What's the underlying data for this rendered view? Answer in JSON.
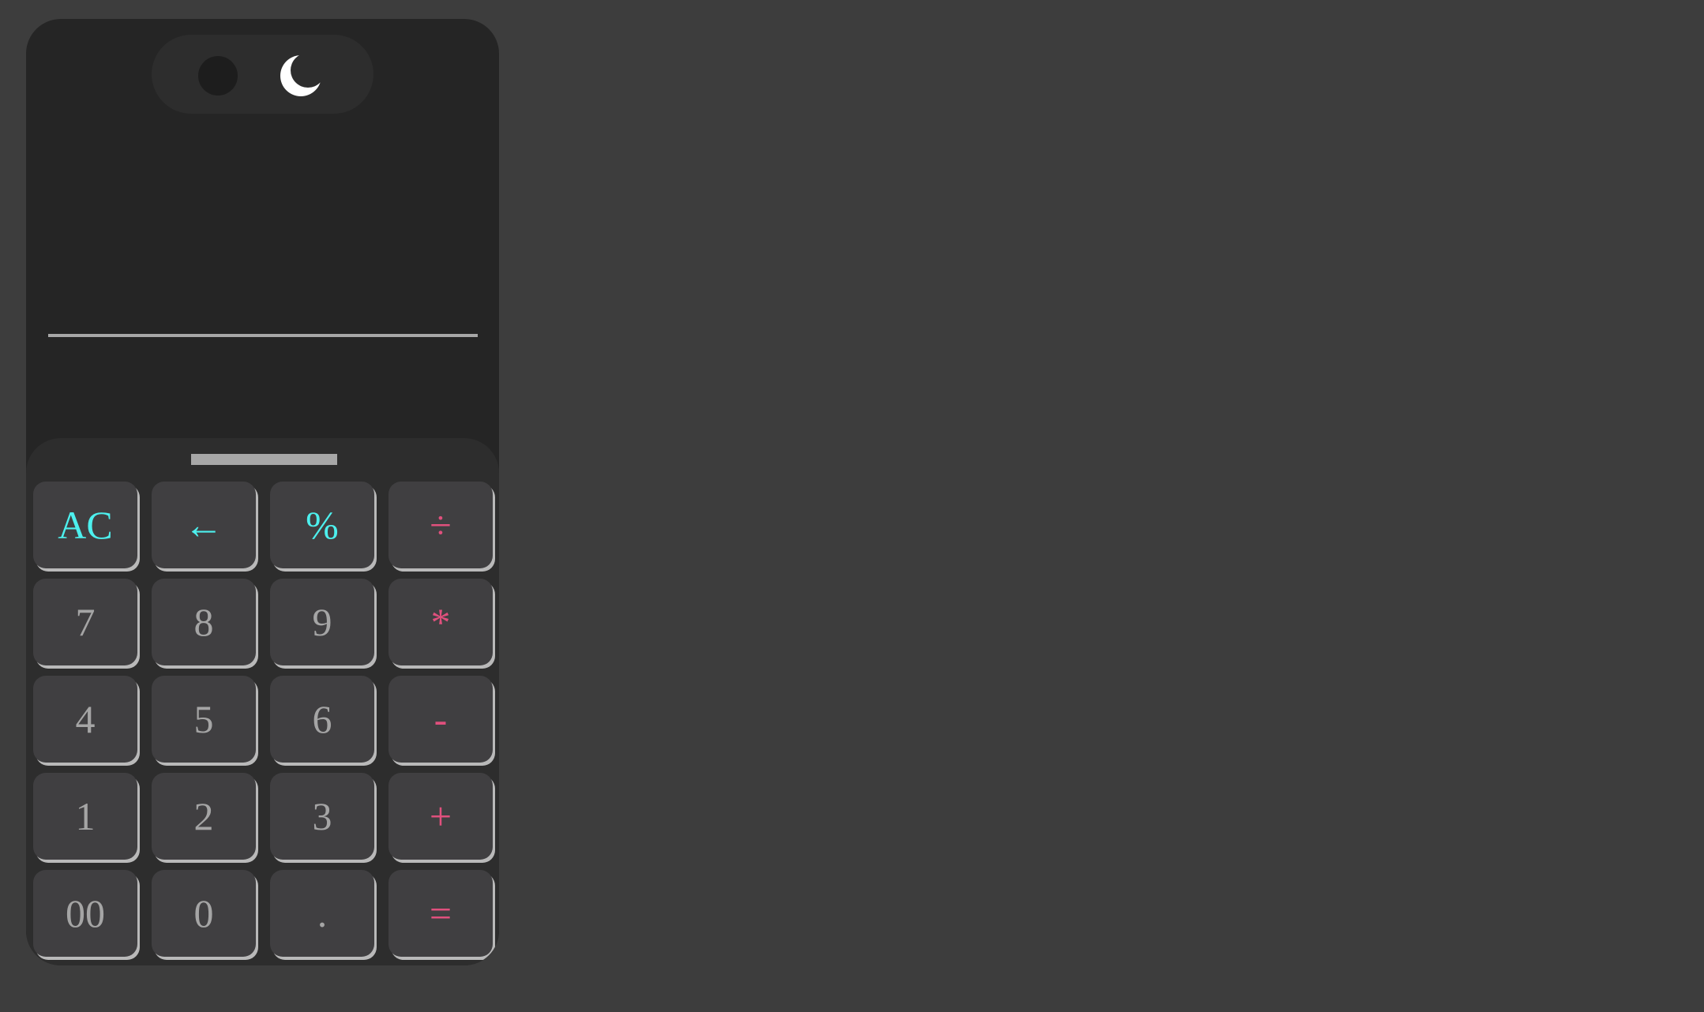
{
  "calculator": {
    "display": {
      "expression": "",
      "result": ""
    },
    "theme_toggle": {
      "dot_icon": "circle-icon",
      "mode_icon": "moon-icon"
    },
    "keys": [
      {
        "label": "AC",
        "kind": "fn",
        "name": "all-clear-button"
      },
      {
        "label": "←",
        "kind": "fn",
        "name": "backspace-button"
      },
      {
        "label": "%",
        "kind": "fn",
        "name": "percent-button"
      },
      {
        "label": "÷",
        "kind": "op",
        "name": "divide-button"
      },
      {
        "label": "7",
        "kind": "num",
        "name": "digit-7-button"
      },
      {
        "label": "8",
        "kind": "num",
        "name": "digit-8-button"
      },
      {
        "label": "9",
        "kind": "num",
        "name": "digit-9-button"
      },
      {
        "label": "*",
        "kind": "op",
        "name": "multiply-button"
      },
      {
        "label": "4",
        "kind": "num",
        "name": "digit-4-button"
      },
      {
        "label": "5",
        "kind": "num",
        "name": "digit-5-button"
      },
      {
        "label": "6",
        "kind": "num",
        "name": "digit-6-button"
      },
      {
        "label": "-",
        "kind": "op",
        "name": "subtract-button"
      },
      {
        "label": "1",
        "kind": "num",
        "name": "digit-1-button"
      },
      {
        "label": "2",
        "kind": "num",
        "name": "digit-2-button"
      },
      {
        "label": "3",
        "kind": "num",
        "name": "digit-3-button"
      },
      {
        "label": "+",
        "kind": "op",
        "name": "add-button"
      },
      {
        "label": "00",
        "kind": "num",
        "name": "double-zero-button"
      },
      {
        "label": "0",
        "kind": "num",
        "name": "digit-0-button"
      },
      {
        "label": ".",
        "kind": "num",
        "name": "decimal-button"
      },
      {
        "label": "=",
        "kind": "op",
        "name": "equals-button"
      }
    ]
  },
  "colors": {
    "page_background": "#3d3d3d",
    "calculator_body": "#252525",
    "keypad_background": "#2d2d2d",
    "key_face": "#403f41",
    "number_text": "#a5a5a5",
    "function_text": "#4df0ee",
    "operator_text": "#e0507d"
  }
}
